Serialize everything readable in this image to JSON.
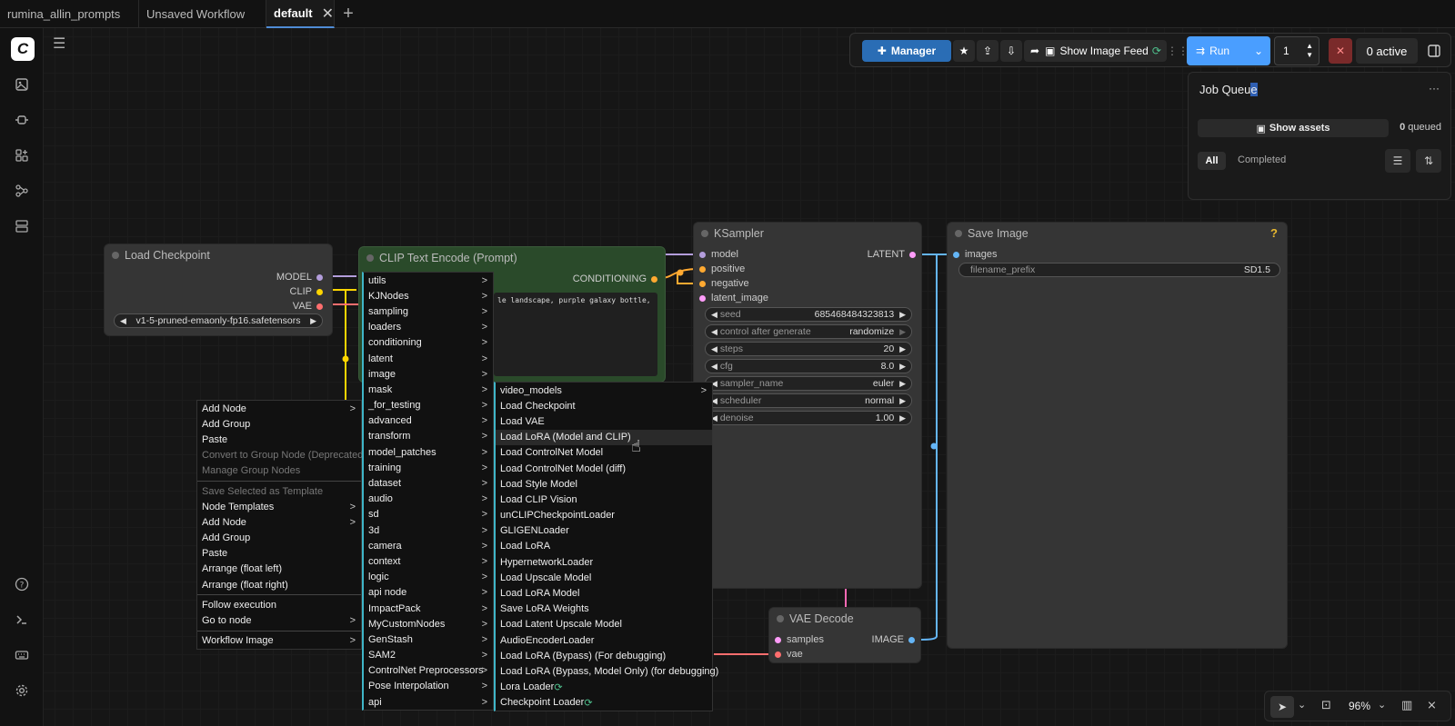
{
  "tabs": [
    {
      "label": "rumina_allin_prompts"
    },
    {
      "label": "Unsaved Workflow"
    },
    {
      "label": "default",
      "close": "✕"
    }
  ],
  "toolbar": {
    "manager_label": "Manager",
    "image_feed_label": "Show Image Feed",
    "run_label": "Run",
    "batch_count": "1",
    "active_label": "0 active"
  },
  "queue": {
    "title_prefix": "Job Queu",
    "title_highlight": "e",
    "more": "···",
    "show_assets": "Show assets",
    "queued_count": "0",
    "queued_label": "queued",
    "tab_all": "All",
    "tab_completed": "Completed"
  },
  "nodes": {
    "load_checkpoint": {
      "title": "Load Checkpoint",
      "outputs": [
        "MODEL",
        "CLIP",
        "VAE"
      ],
      "ckpt_name": "v1-5-pruned-emaonly-fp16.safetensors"
    },
    "clip_text_encode": {
      "title": "CLIP Text Encode (Prompt)",
      "output": "CONDITIONING",
      "text": "le landscape, purple galaxy bottle,"
    },
    "ksampler": {
      "title": "KSampler",
      "inputs": [
        "model",
        "positive",
        "negative",
        "latent_image"
      ],
      "output": "LATENT",
      "widgets": [
        {
          "label": "seed",
          "value": "685468484323813"
        },
        {
          "label": "control after generate",
          "value": "randomize"
        },
        {
          "label": "steps",
          "value": "20"
        },
        {
          "label": "cfg",
          "value": "8.0"
        },
        {
          "label": "sampler_name",
          "value": "euler"
        },
        {
          "label": "scheduler",
          "value": "normal"
        },
        {
          "label": "denoise",
          "value": "1.00"
        }
      ]
    },
    "save_image": {
      "title": "Save Image",
      "help": "?",
      "input": "images",
      "widget_label": "filename_prefix",
      "widget_value": "SD1.5"
    },
    "vae_decode": {
      "title": "VAE Decode",
      "inputs": [
        "samples",
        "vae"
      ],
      "output": "IMAGE"
    }
  },
  "context_menu": [
    {
      "label": "Add Node",
      "sub": true
    },
    {
      "label": "Add Group"
    },
    {
      "label": "Paste"
    },
    {
      "label": "Convert to Group Node (Deprecated)",
      "disabled": true
    },
    {
      "label": "Manage Group Nodes",
      "disabled": true
    },
    {
      "sep": true
    },
    {
      "label": "Save Selected as Template",
      "disabled": true
    },
    {
      "label": "Node Templates",
      "sub": true
    },
    {
      "label": "Add Node",
      "sub": true
    },
    {
      "label": "Add Group"
    },
    {
      "label": "Paste"
    },
    {
      "label": "Arrange (float left)"
    },
    {
      "label": "Arrange (float right)"
    },
    {
      "sep": true
    },
    {
      "label": "Follow execution"
    },
    {
      "label": "Go to node",
      "sub": true
    },
    {
      "sep": true
    },
    {
      "label": "Workflow Image",
      "sub": true
    }
  ],
  "category_menu": [
    "utils",
    "KJNodes",
    "sampling",
    "loaders",
    "conditioning",
    "latent",
    "image",
    "mask",
    "_for_testing",
    "advanced",
    "transform",
    "model_patches",
    "training",
    "dataset",
    "audio",
    "sd",
    "3d",
    "camera",
    "context",
    "logic",
    "api node",
    "ImpactPack",
    "MyCustomNodes",
    "GenStash",
    "SAM2",
    "ControlNet Preprocessors",
    "Pose Interpolation",
    "api"
  ],
  "loaders_menu": [
    "video_models",
    "Load Checkpoint",
    "Load VAE",
    "Load LoRA (Model and CLIP)",
    "Load ControlNet Model",
    "Load ControlNet Model (diff)",
    "Load Style Model",
    "Load CLIP Vision",
    "unCLIPCheckpointLoader",
    "GLIGENLoader",
    "Load LoRA",
    "HypernetworkLoader",
    "Load Upscale Model",
    "Load LoRA Model",
    "Save LoRA Weights",
    "Load Latent Upscale Model",
    "AudioEncoderLoader",
    "Load LoRA (Bypass) (For debugging)",
    "Load LoRA (Bypass, Model Only) (for debugging)",
    "Lora Loader",
    "Checkpoint Loader"
  ],
  "chevron": ">",
  "zoom": "96%",
  "colors": {
    "accent": "#4a9eff",
    "manager": "#2a6db5",
    "cancel": "#7a2a2a"
  }
}
